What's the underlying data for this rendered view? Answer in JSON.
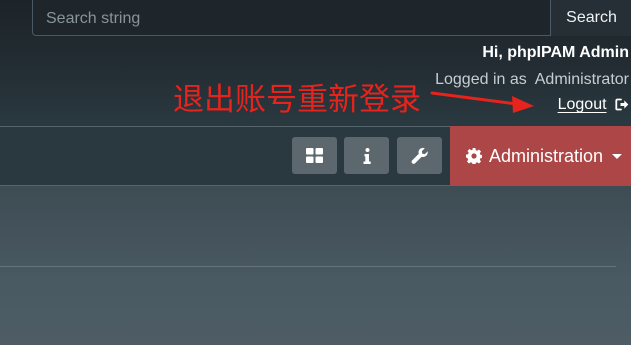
{
  "search": {
    "placeholder": "Search string",
    "value": "",
    "button_label": "Search"
  },
  "user": {
    "greeting": "Hi, phpIPAM Admin",
    "logged_in_prefix": "Logged in as",
    "role": "Administrator",
    "logout_label": "Logout",
    "logout_icon": "sign-out-icon"
  },
  "annotation": {
    "text": "退出账号重新登录",
    "color": "#e6231c",
    "arrow_icon": "red-arrow"
  },
  "navbar": {
    "icon_buttons": [
      {
        "icon": "dashboard-grid-icon"
      },
      {
        "icon": "info-icon"
      },
      {
        "icon": "wrench-icon"
      }
    ],
    "admin_menu": {
      "label": "Administration",
      "icon": "gear-icon",
      "caret": "caret-down-icon",
      "color": "#ad4646"
    }
  },
  "colors": {
    "header_bg": "#1d2429",
    "navbar_bg": "#2a3940",
    "content_bg": "#4a5961",
    "icon_button_bg": "#5c686e"
  }
}
